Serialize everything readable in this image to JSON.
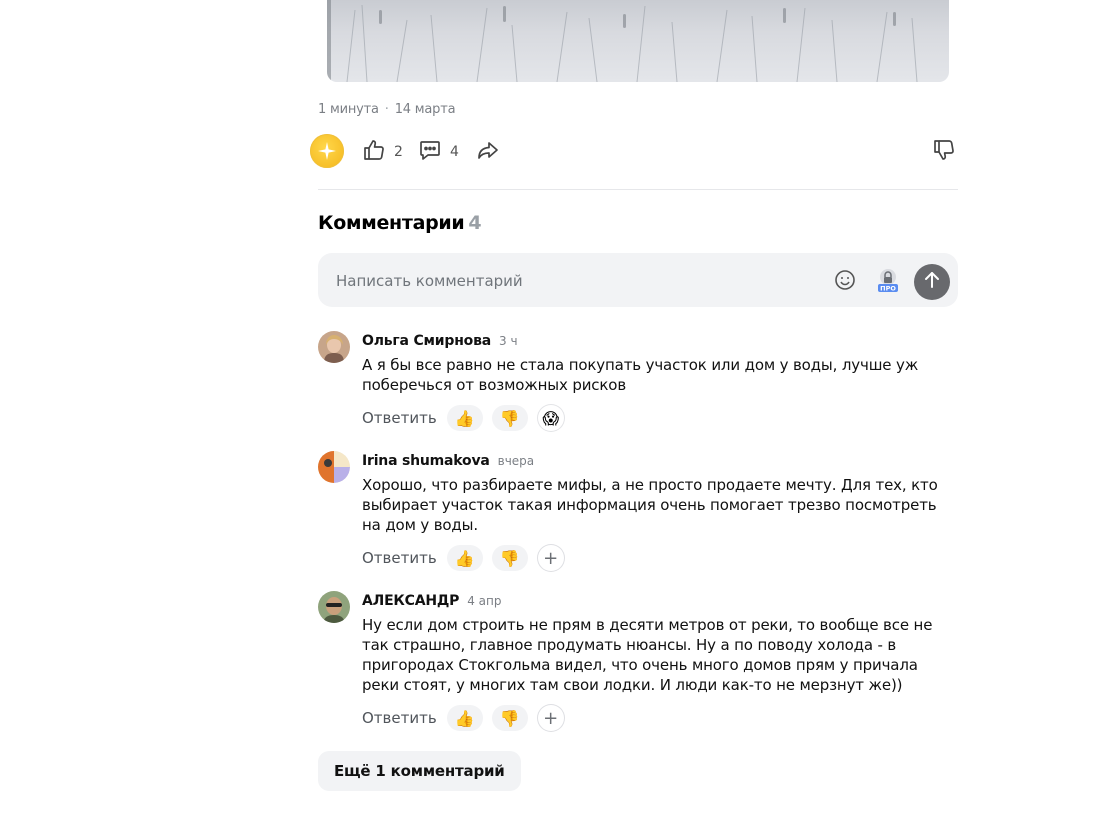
{
  "post": {
    "read_time": "1 минута",
    "separator": "·",
    "date": "14 марта",
    "likes": "2",
    "comments": "4"
  },
  "comments_section": {
    "title": "Комментарии",
    "count": "4",
    "input_placeholder": "Написать комментарий"
  },
  "comments": [
    {
      "author": "Ольга Смирнова",
      "time": "3 ч",
      "text": "А я бы все равно не стала покупать участок или дом у воды, лучше уж поберечься от возможных рисков",
      "reply_label": "Ответить",
      "reactions": [
        "👍",
        "👎",
        "😱"
      ]
    },
    {
      "author": "Irina shumakova",
      "time": "вчера",
      "text": "Хорошо, что разбираете мифы, а не просто продаете мечту. Для тех, кто выбирает участок такая информация очень помогает трезво посмотреть на дом у воды.",
      "reply_label": "Ответить",
      "reactions": [
        "👍",
        "👎",
        "+"
      ]
    },
    {
      "author": "АЛЕКСАНДР",
      "time": "4 апр",
      "text": "Ну если дом строить не прям в десяти метров от реки, то вообще все не так страшно, главное продумать нюансы. Ну а по поводу холода - в пригородах Стокгольма видел, что очень много домов прям у причала реки стоят, у многих там свои лодки. И люди как-то не мерзнут же))",
      "reply_label": "Ответить",
      "reactions": [
        "👍",
        "👎",
        "+"
      ]
    }
  ],
  "more_button": "Ещё 1 комментарий",
  "icons": {
    "star": "star-icon",
    "like": "thumbs-up-icon",
    "comment": "comment-icon",
    "share": "share-icon",
    "dislike": "thumbs-down-icon",
    "emoji": "emoji-icon",
    "pro": "pro-lock-icon",
    "send": "send-arrow-icon"
  },
  "colors": {
    "accent_star": "#f5bd1f",
    "send_button": "#68696d",
    "muted_text": "#7b7f85"
  }
}
